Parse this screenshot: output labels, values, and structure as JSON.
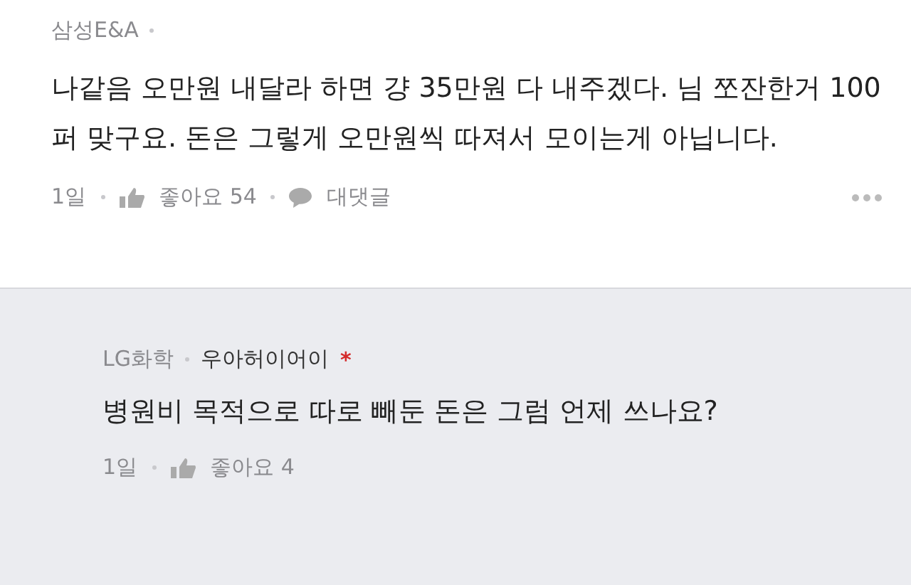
{
  "comment": {
    "company": "삼성E&A",
    "body": "나같음 오만원 내달라 하면 걍 35만원 다 내주겠다. 님 쪼잔한거 100퍼 맞구요. 돈은 그렇게 오만원씩 따져서 모이는게 아닙니다.",
    "time": "1일",
    "likes": "좋아요 54",
    "reply_label": "대댓글"
  },
  "reply": {
    "company": "LG화학",
    "author": "우아허이어이",
    "mark": "*",
    "body": "병원비 목적으로 따로 빼둔 돈은 그럼 언제 쓰나요?",
    "time": "1일",
    "likes": "좋아요 4"
  }
}
